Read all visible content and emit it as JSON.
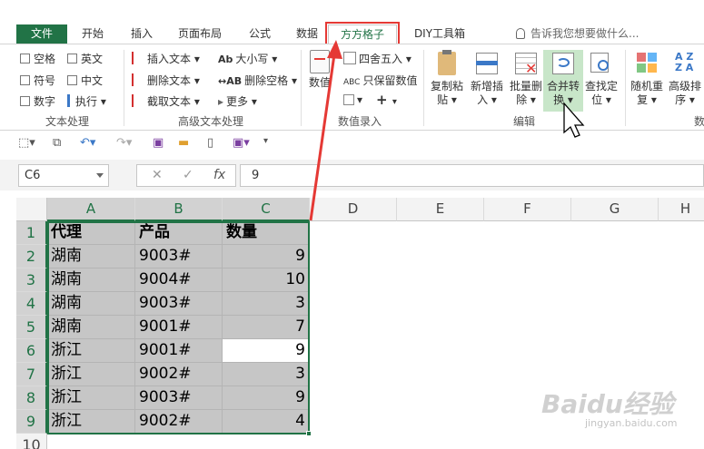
{
  "tabs": {
    "file": "文件",
    "items": [
      "开始",
      "插入",
      "页面布局",
      "公式",
      "数据",
      "方方格子",
      "DIY工具箱"
    ],
    "active": "方方格子",
    "tell_me": "告诉我您想要做什么..."
  },
  "ribbon": {
    "text_group": {
      "label": "文本处理",
      "checkboxes": [
        "空格",
        "英文",
        "符号",
        "中文",
        "数字"
      ],
      "exec": "执行"
    },
    "adv_text_group": {
      "label": "高级文本处理",
      "insert_text": "插入文本",
      "delete_text": "删除文本",
      "cut_text": "截取文本",
      "case": "大小写",
      "delete_space": "删除空格",
      "more": "更多"
    },
    "num_group": {
      "label": "数值录入",
      "numeric": "数值",
      "round": "四舍五入",
      "keep_value": "只保留数值",
      "plus": "+"
    },
    "edit_group": {
      "label": "编辑",
      "copy_paste_l1": "复制粘",
      "copy_paste_l2": "贴",
      "new_insert_l1": "新增插",
      "new_insert_l2": "入",
      "batch_delete_l1": "批量删",
      "batch_delete_l2": "除",
      "merge_l1": "合并转",
      "merge_l2": "换",
      "find_l1": "查找定",
      "find_l2": "位"
    },
    "more_group": {
      "label": "数",
      "random_l1": "随机重",
      "random_l2": "复",
      "adv_sort_l1": "高级排",
      "adv_sort_l2": "序"
    }
  },
  "formula_bar": {
    "name_box": "C6",
    "fx": "fx",
    "value": "9"
  },
  "sheet": {
    "columns": [
      "A",
      "B",
      "C",
      "D",
      "E",
      "F",
      "G",
      "H"
    ],
    "rows": [
      "1",
      "2",
      "3",
      "4",
      "5",
      "6",
      "7",
      "8",
      "9",
      "10"
    ],
    "header": [
      "代理",
      "产品",
      "数量"
    ],
    "data": [
      [
        "湖南",
        "9003#",
        "9"
      ],
      [
        "湖南",
        "9004#",
        "10"
      ],
      [
        "湖南",
        "9003#",
        "3"
      ],
      [
        "湖南",
        "9001#",
        "7"
      ],
      [
        "浙江",
        "9001#",
        "9"
      ],
      [
        "浙江",
        "9002#",
        "3"
      ],
      [
        "浙江",
        "9003#",
        "9"
      ],
      [
        "浙江",
        "9002#",
        "4"
      ]
    ]
  },
  "watermark": {
    "logo": "Baidu经验",
    "url": "jingyan.baidu.com"
  },
  "colors": {
    "excel_green": "#217346",
    "highlight_red": "#e53935"
  }
}
